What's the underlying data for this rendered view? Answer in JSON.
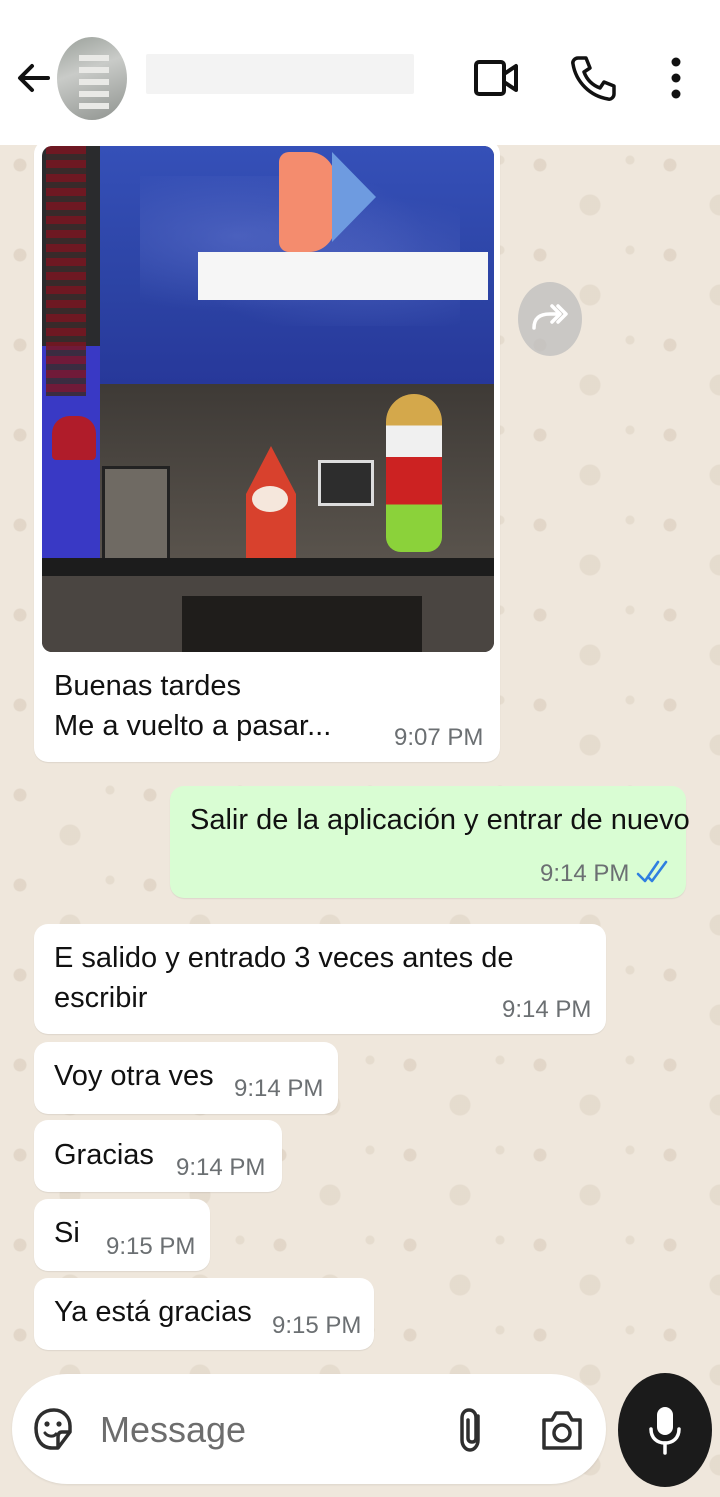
{
  "header": {
    "contact_name": "",
    "icons": [
      "back-arrow-icon",
      "video-call-icon",
      "phone-call-icon",
      "more-vert-icon"
    ]
  },
  "messages": [
    {
      "direction": "incoming",
      "type": "image",
      "lines": [
        "Buenas tardes",
        "Me a vuelto a pasar..."
      ],
      "time": "9:07 PM"
    },
    {
      "direction": "outgoing",
      "lines": [
        "Salir de la aplicación y entrar de nuevo"
      ],
      "time": "9:14 PM",
      "status": "read"
    },
    {
      "direction": "incoming",
      "lines": [
        "E salido y entrado 3 veces antes de",
        "escribir"
      ],
      "time": "9:14 PM"
    },
    {
      "direction": "incoming",
      "lines": [
        "Voy otra ves"
      ],
      "time": "9:14 PM"
    },
    {
      "direction": "incoming",
      "lines": [
        "Gracias"
      ],
      "time": "9:14 PM"
    },
    {
      "direction": "incoming",
      "lines": [
        "Si"
      ],
      "time": "9:15 PM"
    },
    {
      "direction": "incoming",
      "lines": [
        "Ya está gracias"
      ],
      "time": "9:15 PM"
    }
  ],
  "input": {
    "placeholder": "Message",
    "icons": [
      "sticker-icon",
      "attach-icon",
      "camera-icon",
      "mic-icon"
    ]
  },
  "colors": {
    "header_bg": "#ffffff",
    "wallpaper": "#efe7dc",
    "incoming_bubble": "#ffffff",
    "outgoing_bubble": "#d9fdd3",
    "read_tick": "#2f7fe0",
    "mic_button": "#1b1b1b"
  }
}
